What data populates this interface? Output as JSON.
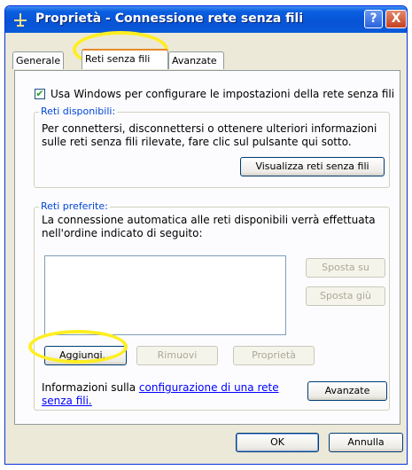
{
  "window": {
    "title": "Proprietà - Connessione rete senza fili"
  },
  "titlebar": {
    "help_label": "?",
    "close_label": "X"
  },
  "tabs": [
    {
      "label": "Generale",
      "active": false
    },
    {
      "label": "Reti senza fili",
      "active": true
    },
    {
      "label": "Avanzate",
      "active": false
    }
  ],
  "use_windows": {
    "checked": true,
    "check_glyph": "✔",
    "label": "Usa Windows per configurare le impostazioni della rete senza fili"
  },
  "available": {
    "title": "Reti disponibili:",
    "line1": "Per connettersi, disconnettersi o ottenere ulteriori informazioni",
    "line2": "sulle reti senza fili rilevate, fare clic sul pulsante qui sotto.",
    "view_button": "Visualizza reti senza fili"
  },
  "preferred": {
    "title": "Reti preferite:",
    "line1": "La connessione automatica alle reti disponibili verrà effettuata",
    "line2": "nell'ordine indicato di seguito:",
    "move_up": "Sposta su",
    "move_down": "Sposta giù",
    "add": "Aggiungi...",
    "remove": "Rimuovi",
    "properties": "Proprietà"
  },
  "info": {
    "prefix": "Informazioni sulla ",
    "link": "configurazione di una rete",
    "link2": "senza fili.",
    "advanced_button": "Avanzate"
  },
  "footer": {
    "ok": "OK",
    "cancel": "Annulla"
  },
  "colors": {
    "titlebar": "#0a5fe0",
    "highlight": "#ffee22",
    "group_title": "#0046d5",
    "link": "#0000ff"
  }
}
